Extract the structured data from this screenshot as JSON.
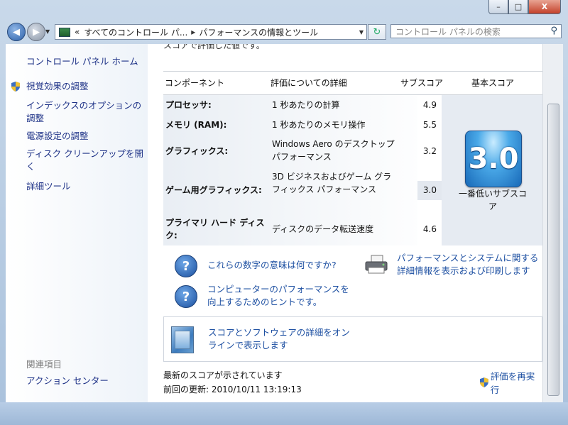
{
  "window": {
    "caption_buttons": {
      "minimize": "–",
      "maximize": "□",
      "close": "X"
    }
  },
  "nav": {
    "back_glyph": "◀",
    "forward_glyph": "▶",
    "address": {
      "prefix": "«",
      "crumb1": "すべてのコントロール パ...",
      "separator": "▸",
      "crumb2": "パフォーマンスの情報とツール"
    },
    "search_placeholder": "コントロール パネルの検索"
  },
  "sidebar": {
    "home": "コントロール パネル ホーム",
    "links": [
      "視覚効果の調整",
      "インデックスのオプションの調整",
      "電源設定の調整",
      "ディスク クリーンアップを開く",
      "詳細ツール"
    ],
    "related_header": "関連項目",
    "related": [
      "アクション センター"
    ]
  },
  "main": {
    "top_text": "スコアで評価した値です。",
    "table": {
      "headers": [
        "コンポーネント",
        "評価についての詳細",
        "サブスコア",
        "基本スコア"
      ],
      "rows": [
        {
          "component": "プロセッサ:",
          "detail": "1 秒あたりの計算",
          "subscore": "4.9"
        },
        {
          "component": "メモリ (RAM):",
          "detail": "1 秒あたりのメモリ操作",
          "subscore": "5.5"
        },
        {
          "component": "グラフィックス:",
          "detail": "Windows Aero のデスクトップ パフォーマンス",
          "subscore": "3.2"
        },
        {
          "component": "ゲーム用グラフィックス:",
          "detail": "3D ビジネスおよびゲーム グラフィックス パフォーマンス",
          "subscore": "3.0"
        },
        {
          "component": "プライマリ ハード ディスク:",
          "detail": "ディスクのデータ転送速度",
          "subscore": "4.6"
        }
      ],
      "base_score": "3.0",
      "base_caption": "一番低いサブスコア"
    },
    "links": {
      "meaning": "これらの数字の意味は何ですか?",
      "tips": "コンピューターのパフォーマンスを向上するためのヒントです。",
      "print": "パフォーマンスとシステムに関する詳細情報を表示および印刷します",
      "online": "スコアとソフトウェアの詳細をオンラインで表示します"
    },
    "status": "最新のスコアが示されています",
    "last_updated": "前回の更新: 2010/10/11 13:19:13",
    "rerun": "評価を再実行"
  }
}
